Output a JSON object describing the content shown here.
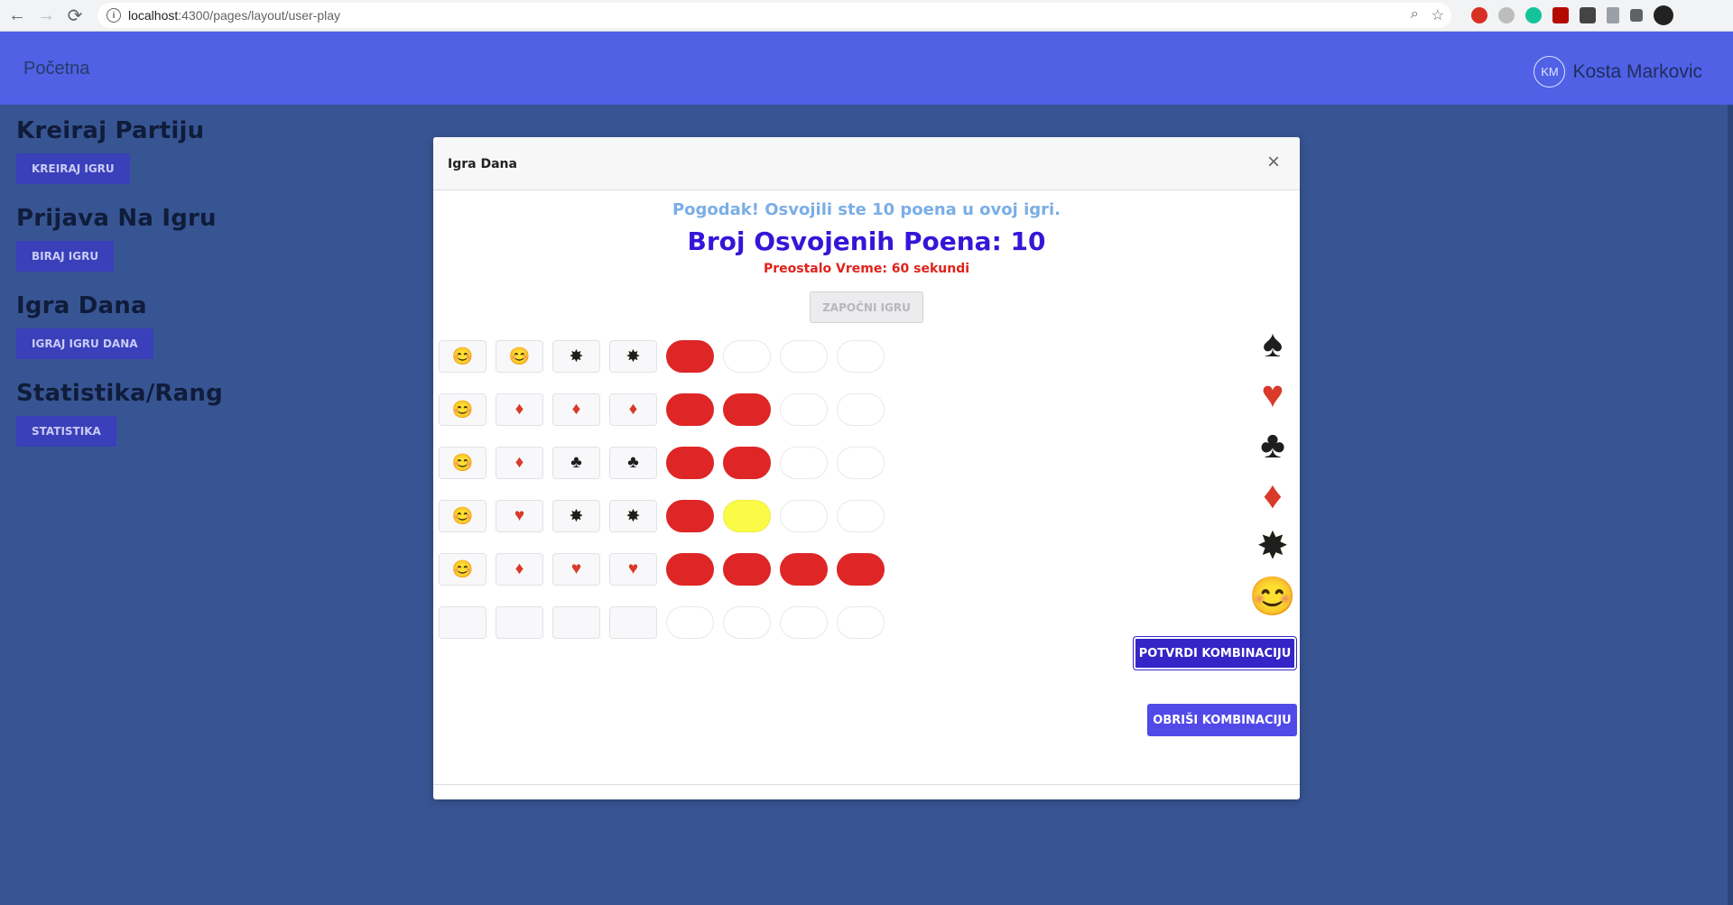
{
  "browser": {
    "url_host": "localhost",
    "url_rest": ":4300/pages/layout/user-play"
  },
  "header": {
    "home_label": "Početna",
    "avatar_initials": "KM",
    "user_name": "Kosta Markovic"
  },
  "sidebar": {
    "sections": [
      {
        "title": "Kreiraj Partiju",
        "button": "KREIRAJ IGRU"
      },
      {
        "title": "Prijava Na Igru",
        "button": "BIRAJ IGRU"
      },
      {
        "title": "Igra Dana",
        "button": "IGRAJ IGRU DANA"
      },
      {
        "title": "Statistika/Rang",
        "button": "STATISTIKA"
      }
    ]
  },
  "modal": {
    "title": "Igra Dana",
    "close_glyph": "×",
    "success_message": "Pogodak! Osvojili ste 10 poena u ovoj igri.",
    "points_text": "Broj Osvojenih Poena: 10",
    "timer_text": "Preostalo Vreme: 60 sekundi",
    "start_button": "ZAPOČNI IGRU",
    "confirm_button": "POTVRDI KOMBINACIJU",
    "clear_button": "OBRIŠI KOMBINACIJU"
  },
  "symbols": {
    "smiley": "😊",
    "diamond": "♦",
    "club": "♣",
    "heart": "♥",
    "spade": "♠",
    "star": "✸"
  },
  "attempts": [
    {
      "symbols": [
        "smiley",
        "smiley",
        "star",
        "star"
      ],
      "pegs": [
        "red",
        "empty",
        "empty",
        "empty"
      ]
    },
    {
      "symbols": [
        "smiley",
        "diamond",
        "diamond",
        "diamond"
      ],
      "pegs": [
        "red",
        "red",
        "empty",
        "empty"
      ]
    },
    {
      "symbols": [
        "smiley",
        "diamond",
        "club",
        "club"
      ],
      "pegs": [
        "red",
        "red",
        "empty",
        "empty"
      ]
    },
    {
      "symbols": [
        "smiley",
        "heart",
        "star",
        "star"
      ],
      "pegs": [
        "red",
        "yellow",
        "empty",
        "empty"
      ]
    },
    {
      "symbols": [
        "smiley",
        "diamond",
        "heart",
        "heart"
      ],
      "pegs": [
        "red",
        "red",
        "red",
        "red"
      ]
    },
    {
      "symbols": [
        "",
        "",
        "",
        ""
      ],
      "pegs": [
        "empty",
        "empty",
        "empty",
        "empty"
      ]
    }
  ],
  "palette": [
    "spade",
    "heart",
    "club",
    "diamond",
    "star",
    "smiley"
  ],
  "colors": {
    "header_bg": "#5061e6",
    "page_bg": "#385593",
    "peg_red": "#de2626",
    "peg_yellow": "#fafa47",
    "confirm_bg": "#3525c7",
    "clear_bg": "#5249e9"
  }
}
